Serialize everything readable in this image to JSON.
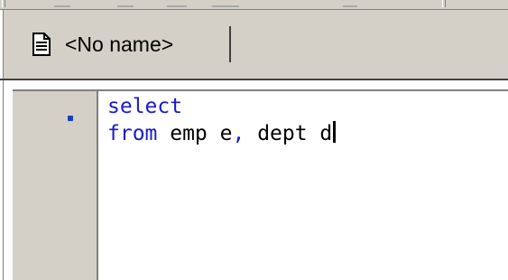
{
  "tab": {
    "label": "<No name>",
    "icon": "document-icon"
  },
  "editor": {
    "lines": [
      {
        "tokens": [
          {
            "text": "select",
            "kind": "keyword"
          }
        ]
      },
      {
        "tokens": [
          {
            "text": "from",
            "kind": "keyword"
          },
          {
            "text": " emp e",
            "kind": "plain"
          },
          {
            "text": ",",
            "kind": "punct"
          },
          {
            "text": " dept d",
            "kind": "plain"
          }
        ]
      }
    ],
    "current_line_marker": "current-line-marker-icon"
  },
  "colors": {
    "keyword": "#1a1acc",
    "plain": "#000000",
    "gutter": "#d4d0c8",
    "background": "#ffffff",
    "marker": "#1a3cc8"
  }
}
